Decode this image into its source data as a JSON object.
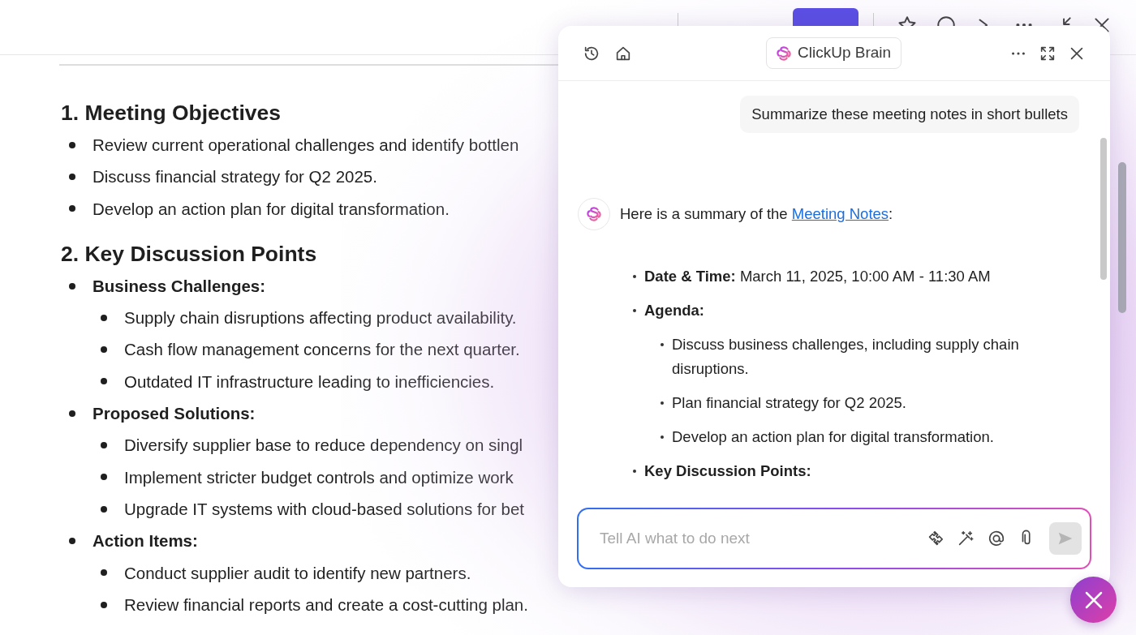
{
  "document": {
    "sections": [
      {
        "heading": "1. Meeting Objectives",
        "items": [
          {
            "text": "Review current operational challenges and identify bottlen",
            "bold": false
          },
          {
            "text": "Discuss financial strategy for Q2 2025.",
            "bold": false
          },
          {
            "text": "Develop an action plan for digital transformation.",
            "bold": false
          }
        ]
      },
      {
        "heading": "2. Key Discussion Points",
        "items": [
          {
            "text": "Business Challenges:",
            "bold": true,
            "children": [
              {
                "text": "Supply chain disruptions affecting product availability.",
                "bold": false
              },
              {
                "text": "Cash flow management concerns for the next quarter.",
                "bold": false
              },
              {
                "text": "Outdated IT infrastructure leading to inefficiencies.",
                "bold": false
              }
            ]
          },
          {
            "text": "Proposed Solutions:",
            "bold": true,
            "children": [
              {
                "text": "Diversify supplier base to reduce dependency on singl",
                "bold": false
              },
              {
                "text": "Implement stricter budget controls and optimize work",
                "bold": false
              },
              {
                "text": "Upgrade IT systems with cloud-based solutions for bet",
                "bold": false
              }
            ]
          },
          {
            "text": "Action Items:",
            "bold": true,
            "children": [
              {
                "text": "Conduct supplier audit to identify new partners.",
                "bold": false
              },
              {
                "text": "Review financial reports and create a cost-cutting plan.",
                "bold": false
              }
            ]
          }
        ]
      }
    ]
  },
  "ai_panel": {
    "title": "ClickUp Brain",
    "messages": [
      {
        "kind": "user",
        "text": "Summarize these meeting notes in short bullets"
      },
      {
        "kind": "assistant",
        "intro": "Here is a summary of the ",
        "link": "Meeting Notes",
        "after": ":",
        "summary": [
          {
            "text": "**Date & Time:** March 11, 2025, 10:00 AM - 11:30 AM"
          },
          {
            "text": "**Agenda:**",
            "children": [
              {
                "text": "Discuss business challenges, including supply chain disruptions."
              },
              {
                "text": "Plan financial strategy for Q2 2025."
              },
              {
                "text": "Develop an action plan for digital transformation."
              }
            ]
          },
          {
            "text": "**Key Discussion Points:**"
          }
        ]
      }
    ],
    "input": {
      "placeholder": "Tell AI what to do next"
    }
  }
}
